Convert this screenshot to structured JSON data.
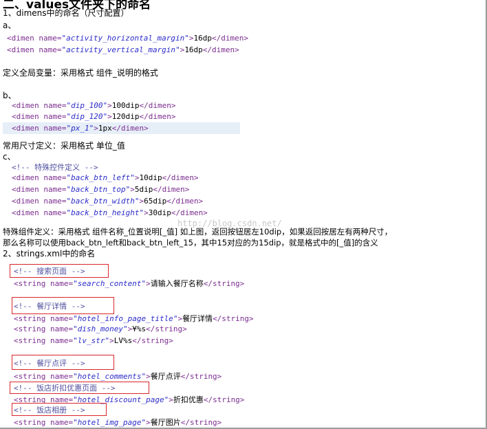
{
  "doc": {
    "title": "二、values文件夹下的命名",
    "h_dimens": "1、dimens中的命名（尺寸配置）",
    "a_label": "a、",
    "a_lines": [
      {
        "name": "activity_horizontal_margin",
        "value": "16dp"
      },
      {
        "name": "activity_vertical_margin",
        "value": "16dp"
      }
    ],
    "global_def": "定义全局变量：采用格式 组件_说明的格式",
    "b_label": "b、",
    "b_lines": [
      {
        "name": "dip_100",
        "value": "100dip"
      },
      {
        "name": "dip_120",
        "value": "120dip"
      },
      {
        "name": "px_1",
        "value": "1px"
      }
    ],
    "common_def": "常用尺寸定义：采用格式 单位_值",
    "c_label": "c、",
    "c_comment": "特殊控件定义",
    "c_lines": [
      {
        "name": "back_btn_left",
        "value": "10dip"
      },
      {
        "name": "back_btn_top",
        "value": "5dip"
      },
      {
        "name": "back_btn_width",
        "value": "65dip"
      },
      {
        "name": "back_btn_height",
        "value": "30dip"
      }
    ],
    "special_1": "特殊组件定义：采用格式 组件名称_位置说明[_值] 如上图，返回按钮居左10dip，如果返回按居左有两种尺寸，",
    "special_2": "那么名称可以使用back_btn_left和back_btn_left_15，其中15对应的为15dip，就是格式中的[_值]的含义",
    "h_strings": "2、strings.xml中的命名",
    "groups": [
      {
        "comment": "搜索页面",
        "lines": [
          {
            "name": "search_content",
            "value": "请输入餐厅名称"
          }
        ]
      },
      {
        "comment": "餐厅详情",
        "lines": [
          {
            "name": "hotel_info_page_title",
            "value": "餐厅详情"
          },
          {
            "name": "dish_money",
            "value": "¥%s"
          },
          {
            "name": "lv_str",
            "value": "LV%s"
          }
        ]
      },
      {
        "comment": "餐厅点评",
        "lines": [
          {
            "name": "hotel_comments",
            "value": "餐厅点评"
          }
        ]
      },
      {
        "comment": "饭店折扣优惠页面",
        "lines": [
          {
            "name": "hotel_discount_page",
            "value": "折扣优惠"
          }
        ]
      },
      {
        "comment": "饭店相册",
        "lines": [
          {
            "name": "hotel_img_page",
            "value": "餐厅图片"
          }
        ]
      }
    ],
    "watermark": "http://blog.csdn.net/"
  }
}
